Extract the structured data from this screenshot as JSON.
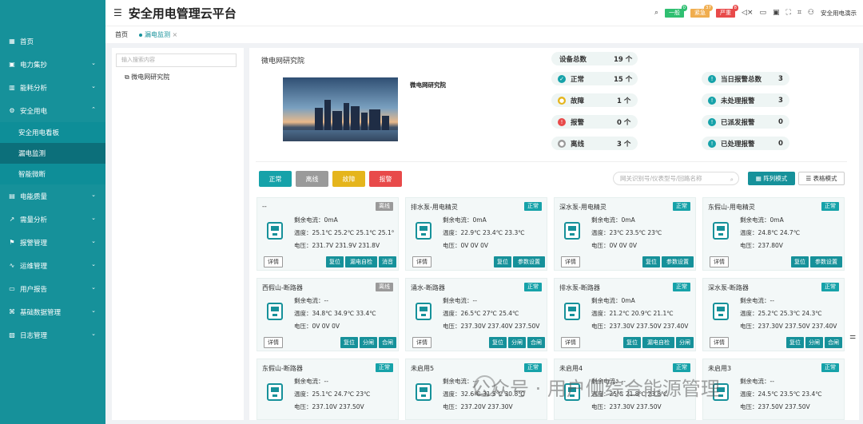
{
  "header": {
    "title": "安全用电管理云平台",
    "alarms": [
      {
        "label": "一般",
        "count": "0",
        "color": "#2fbf71"
      },
      {
        "label": "紧急",
        "count": "37",
        "color": "#f0ad4e"
      },
      {
        "label": "严重",
        "count": "8",
        "color": "#e84a4a"
      }
    ],
    "user": "安全用电演示"
  },
  "tabs": [
    "首页",
    "漏电监测"
  ],
  "sidebar": {
    "items": [
      "首页",
      "电力集抄",
      "能耗分析",
      "安全用电",
      "安全用电看板",
      "漏电监测",
      "智能微断",
      "电能质量",
      "需量分析",
      "报警管理",
      "运维管理",
      "用户报告",
      "基础数据管理",
      "日志管理"
    ]
  },
  "tree": {
    "placeholder": "输入搜索内容",
    "node": "微电网研究院"
  },
  "org": {
    "name": "微电网研究院",
    "caption": "微电网研究院"
  },
  "summary": {
    "total_label": "设备总数",
    "total": "19 个",
    "normal_label": "正常",
    "normal": "15 个",
    "fault_label": "故障",
    "fault": "1 个",
    "alarm_label": "报警",
    "alarm": "0 个",
    "offline_label": "离线",
    "offline": "3 个",
    "today_label": "当日报警总数",
    "today": "3",
    "unhandled_label": "未处理报警",
    "unhandled": "3",
    "dispatched_label": "已派发报警",
    "dispatched": "0",
    "handled_label": "已处理报警",
    "handled": "0"
  },
  "filters": [
    {
      "label": "正常",
      "color": "#16a2a9"
    },
    {
      "label": "离线",
      "color": "#9a9a9a"
    },
    {
      "label": "故障",
      "color": "#e5b51c"
    },
    {
      "label": "报警",
      "color": "#e84a4a"
    }
  ],
  "device_search": "网关识别号/仪表型号/回路名称",
  "modes": {
    "grid": "阵列模式",
    "table": "表格模式"
  },
  "cards": [
    {
      "name": "--",
      "status": "离线",
      "l1": "剩余电流：0mA",
      "l2": "温度：25.1℃ 25.2℃ 25.1℃ 25.1℃",
      "l3": "电压：231.7V 231.9V 231.8V",
      "btns": [
        "复位",
        "漏电自检",
        "消音"
      ]
    },
    {
      "name": "排水泵-用电精灵",
      "status": "正常",
      "l1": "剩余电流：0mA",
      "l2": "温度：22.9℃ 23.4℃ 23.3℃",
      "l3": "电压：0V 0V 0V",
      "btns": [
        "复位",
        "参数设置"
      ]
    },
    {
      "name": "深水泵-用电精灵",
      "status": "正常",
      "l1": "剩余电流：0mA",
      "l2": "温度：23℃ 23.5℃ 23℃",
      "l3": "电压：0V 0V 0V",
      "btns": [
        "复位",
        "参数设置"
      ]
    },
    {
      "name": "东假山-用电精灵",
      "status": "正常",
      "l1": "剩余电流：0mA",
      "l2": "温度：24.8℃ 24.7℃",
      "l3": "电压：237.80V",
      "btns": [
        "复位",
        "参数设置"
      ]
    },
    {
      "name": "西假山-断路器",
      "status": "离线",
      "l1": "剩余电流：--",
      "l2": "温度：34.8℃ 34.9℃ 33.4℃",
      "l3": "电压：0V 0V 0V",
      "btns": [
        "复位",
        "分闸",
        "合闸"
      ]
    },
    {
      "name": "涌水-断路器",
      "status": "正常",
      "l1": "剩余电流：--",
      "l2": "温度：26.5℃ 27℃ 25.4℃",
      "l3": "电压：237.30V 237.40V 237.50V",
      "btns": [
        "复位",
        "分闸",
        "合闸"
      ]
    },
    {
      "name": "排水泵-断路器",
      "status": "正常",
      "l1": "剩余电流：0mA",
      "l2": "温度：21.2℃ 20.9℃ 21.1℃",
      "l3": "电压：237.30V 237.50V 237.40V",
      "btns": [
        "复位",
        "漏电自检",
        "分闸"
      ]
    },
    {
      "name": "深水泵-断路器",
      "status": "正常",
      "l1": "剩余电流：--",
      "l2": "温度：25.2℃ 25.3℃ 24.3℃",
      "l3": "电压：237.30V 237.50V 237.40V",
      "btns": [
        "复位",
        "分闸",
        "合闸"
      ]
    },
    {
      "name": "东假山-断路器",
      "status": "正常",
      "l1": "剩余电流：--",
      "l2": "温度：25.1℃ 24.7℃ 23℃",
      "l3": "电压：237.10V 237.50V",
      "btns": []
    },
    {
      "name": "未启用5",
      "status": "正常",
      "l1": "剩余电流：--",
      "l2": "温度：32.6℃ 31.5℃ 30.8℃",
      "l3": "电压：237.20V 237.30V",
      "btns": []
    },
    {
      "name": "未启用4",
      "status": "正常",
      "l1": "剩余电流：--",
      "l2": "温度：25℃ 21.8℃ 23.8℃",
      "l3": "电压：237.30V 237.50V",
      "btns": []
    },
    {
      "name": "未启用3",
      "status": "正常",
      "l1": "剩余电流：--",
      "l2": "温度：24.5℃ 23.5℃ 23.4℃",
      "l3": "电压：237.50V 237.50V",
      "btns": []
    }
  ],
  "detail_label": "详情",
  "watermark": "公众号 · 用户侧综合能源管理"
}
